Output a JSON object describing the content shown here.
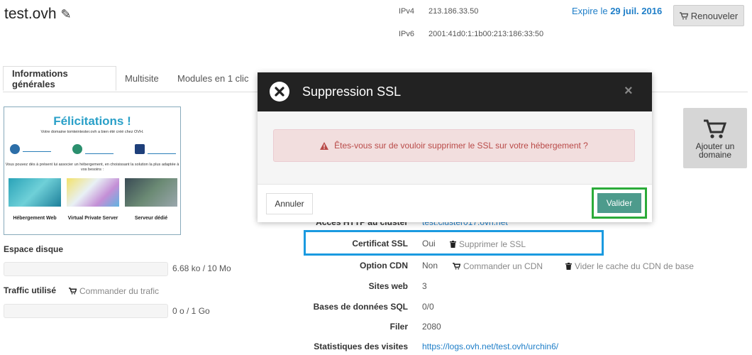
{
  "header": {
    "title": "test.ovh",
    "ipv4_label": "IPv4",
    "ipv4_value": "213.186.33.50",
    "ipv6_label": "IPv6",
    "ipv6_value": "2001:41d0:1:1b00:213:186:33:50",
    "expire_prefix": "Expire le",
    "expire_date": "29 juil. 2016",
    "renew_label": "Renouveler"
  },
  "tabs": [
    {
      "label": "Informations générales"
    },
    {
      "label": "Multisite"
    },
    {
      "label": "Modules en 1 clic"
    }
  ],
  "preview": {
    "title": "Félicitations !",
    "subtitle": "Votre domaine tomteintester.ovh a bien été créé chez OVH.",
    "body": "Vous pouvez dès à présent lui associer un hébergement, en choisissant la solution la plus adaptée à vos besoins :",
    "captions": [
      "Hébergement Web",
      "Virtual Private Server",
      "Serveur dédié"
    ]
  },
  "left": {
    "disk_label": "Espace disque",
    "disk_value": "6.68 ko / 10 Mo",
    "traffic_label": "Traffic utilisé",
    "traffic_order": "Commander du trafic",
    "traffic_value": "0 o / 1 Go"
  },
  "add_domain": {
    "line1": "Ajouter un",
    "line2": "domaine"
  },
  "modal": {
    "title": "Suppression SSL",
    "close": "×",
    "message": "Êtes-vous sur de vouloir supprimer le SSL sur votre hébergement ?",
    "cancel": "Annuler",
    "confirm": "Valider"
  },
  "details": {
    "http_label": "Accès HTTP au cluster",
    "http_value": "test.cluster017.ovh.net",
    "ssl_label": "Certificat SSL",
    "ssl_value": "Oui",
    "ssl_action": "Supprimer le SSL",
    "cdn_label": "Option CDN",
    "cdn_value": "Non",
    "cdn_order": "Commander un CDN",
    "cdn_clear": "Vider le cache du CDN de base",
    "sites_label": "Sites web",
    "sites_value": "3",
    "db_label": "Bases de données SQL",
    "db_value": "0/0",
    "filer_label": "Filer",
    "filer_value": "2080",
    "stats_label": "Statistiques des visites",
    "stats_value": "https://logs.ovh.net/test.ovh/urchin6/"
  },
  "colors": {
    "accent": "#1e7ec8",
    "valider": "#4d9b8c",
    "alert_bg": "#f2dede",
    "alert_text": "#b94a48"
  }
}
